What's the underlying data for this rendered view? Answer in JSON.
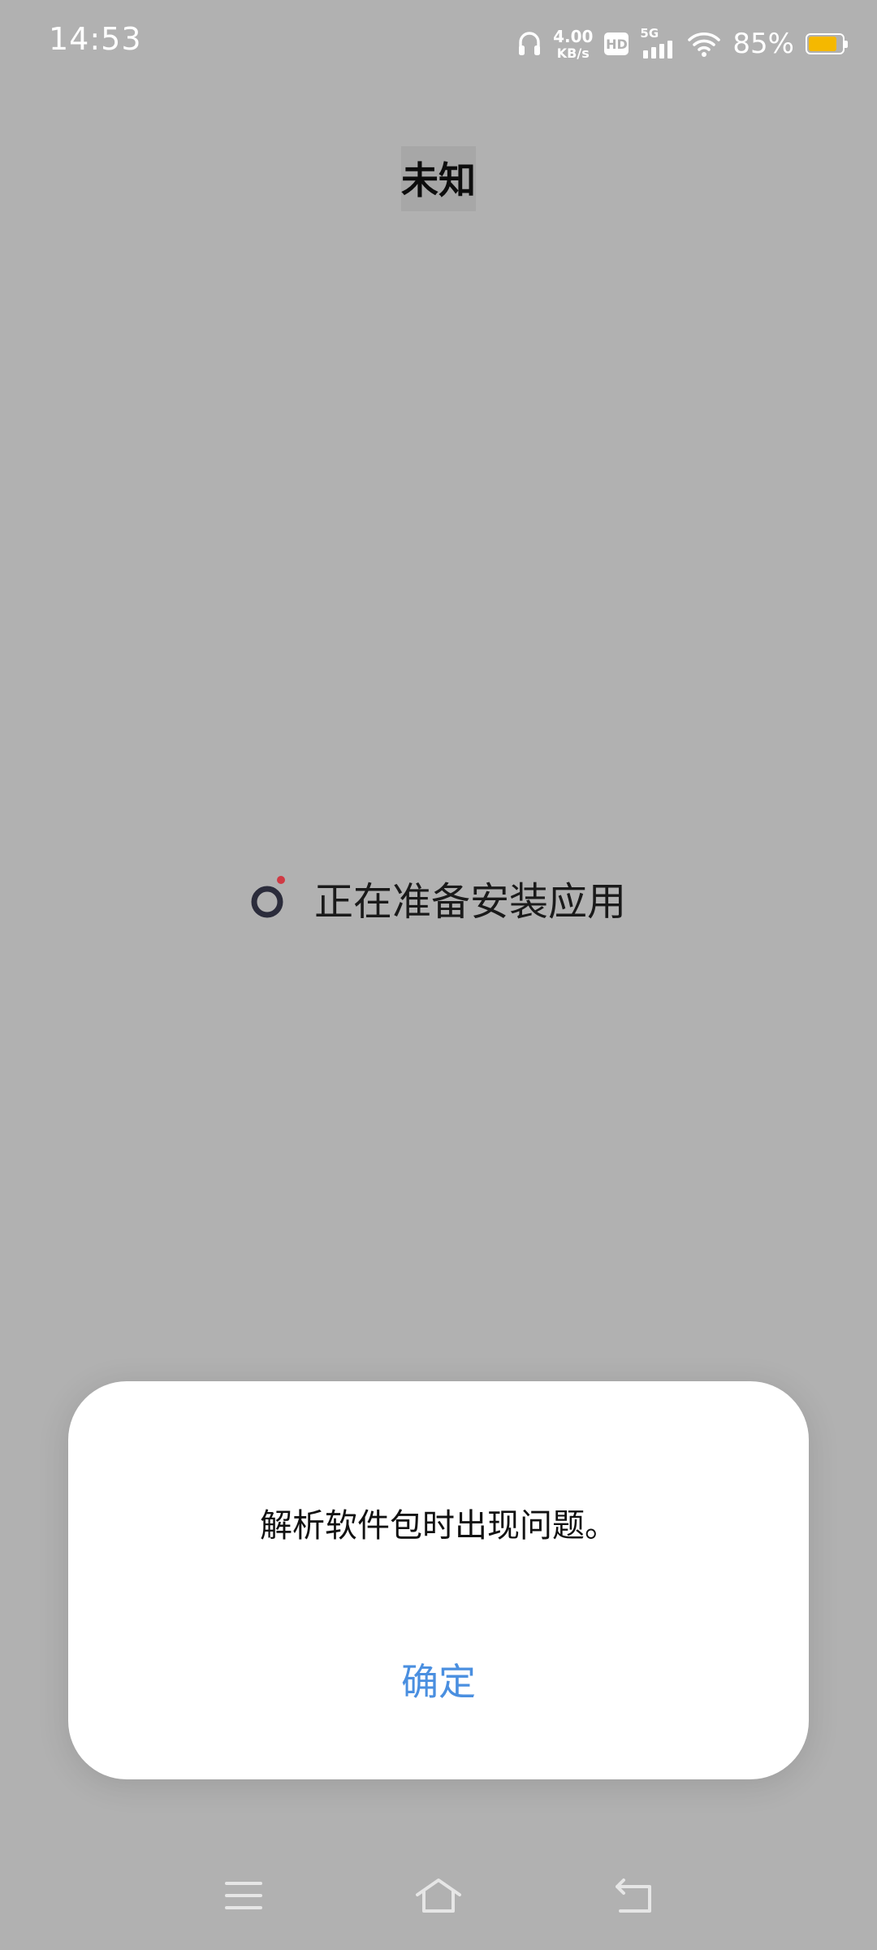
{
  "status_bar": {
    "time": "14:53",
    "net_speed_value": "4.00",
    "net_speed_unit": "KB/s",
    "hd_label": "HD",
    "network_type": "5G",
    "battery_percent": "85%",
    "battery_level": 0.85,
    "battery_color": "#f5b800",
    "icons": [
      "headphones-icon",
      "hd-icon",
      "signal-icon",
      "wifi-icon",
      "battery-icon"
    ]
  },
  "header": {
    "title": "未知"
  },
  "progress": {
    "text": "正在准备安装应用",
    "icon": "loading-spinner-icon"
  },
  "dialog": {
    "message": "解析软件包时出现问题。",
    "confirm_label": "确定",
    "confirm_color": "#4a8fe0"
  },
  "nav_bar": {
    "buttons": [
      "menu-icon",
      "home-icon",
      "back-icon"
    ]
  }
}
